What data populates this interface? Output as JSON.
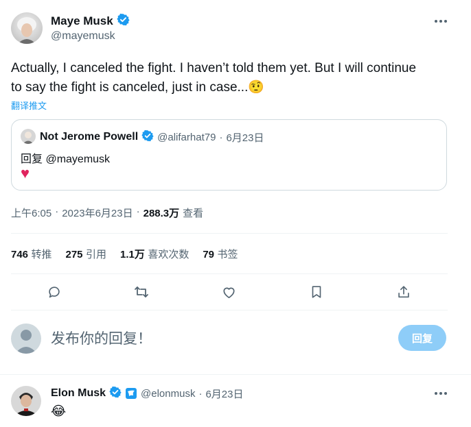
{
  "tweet": {
    "author_name": "Maye Musk",
    "author_handle": "@mayemusk",
    "text_line1": "Actually, I canceled the fight. I haven’t told them yet. But I will continue",
    "text_line2": "to say the fight is canceled, just in case...",
    "emoji": "🤨",
    "translate_label": "翻译推文"
  },
  "quote": {
    "author_name": "Not Jerome Powell",
    "author_handle": "@alifarhat79",
    "separator": "·",
    "date": "6月23日",
    "reply_to": "回复 @mayemusk",
    "heart": "♥"
  },
  "meta": {
    "time": "上午6:05",
    "sep1": "·",
    "date": "2023年6月23日",
    "sep2": "·",
    "views_count": "288.3万",
    "views_label": "查看"
  },
  "stats": {
    "retweets_count": "746",
    "retweets_label": "转推",
    "quotes_count": "275",
    "quotes_label": "引用",
    "likes_count": "1.1万",
    "likes_label": "喜欢次数",
    "bookmarks_count": "79",
    "bookmarks_label": "书签"
  },
  "actions": [
    "reply-icon",
    "retweet-icon",
    "like-icon",
    "bookmark-icon",
    "share-icon"
  ],
  "composer": {
    "placeholder": "发布你的回复！",
    "button_label": "回复"
  },
  "reply": {
    "author_name": "Elon Musk",
    "author_handle": "@elonmusk",
    "separator": "·",
    "date": "6月23日",
    "emoji": "😂"
  },
  "colors": {
    "verified_blue": "#1d9bf0",
    "reply_button_disabled": "#8ecdf8",
    "heart_red": "#f91880",
    "text_secondary": "#536471",
    "link_blue": "#1d9bf0"
  }
}
